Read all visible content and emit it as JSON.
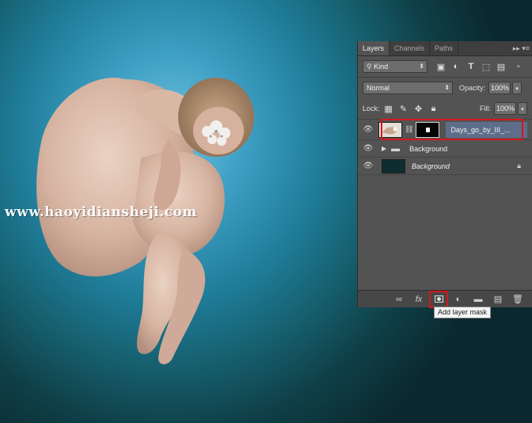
{
  "watermark": "www.haoyidiansheji.com",
  "panel": {
    "tabs": [
      "Layers",
      "Channels",
      "Paths"
    ],
    "menu": "▸▸ ▾≡",
    "filter_kind": "Kind",
    "blend_mode": "Normal",
    "opacity_label": "Opacity:",
    "opacity_value": "100%",
    "lock_label": "Lock:",
    "fill_label": "Fill:",
    "fill_value": "100%",
    "layers": [
      {
        "name": "Days_go_by_III_...",
        "selected": true
      },
      {
        "name": "Background",
        "type": "group"
      },
      {
        "name": "Background",
        "locked": true
      }
    ]
  },
  "tooltip": "Add layer mask",
  "colors": {
    "highlight": "#d7161b",
    "selected_layer": "#5e6e8a",
    "panel_bg": "#535353"
  }
}
